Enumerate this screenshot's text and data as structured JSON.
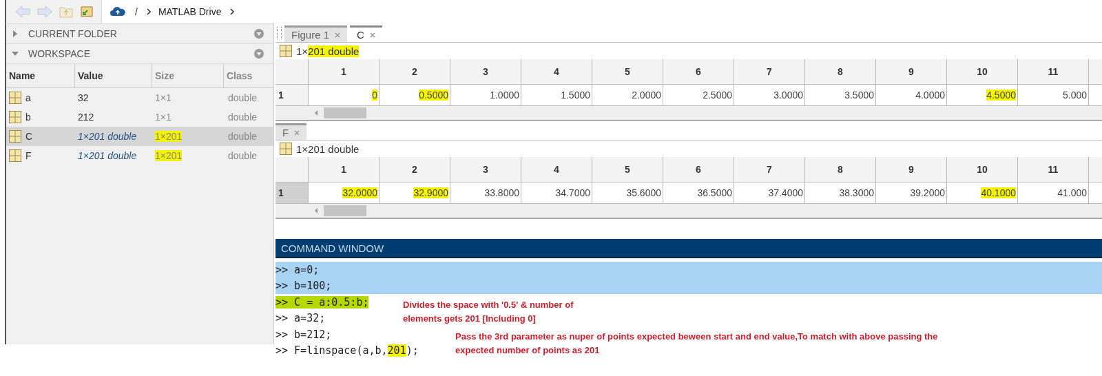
{
  "toolbar": {
    "separator": "/",
    "location": "MATLAB Drive"
  },
  "sidebar": {
    "sections": [
      {
        "title": "CURRENT FOLDER",
        "expanded": false
      },
      {
        "title": "WORKSPACE",
        "expanded": true
      }
    ]
  },
  "workspace": {
    "columns": [
      "Name",
      "Value",
      "Size",
      "Class"
    ],
    "rows": [
      {
        "name": "a",
        "value": "32",
        "kind": "scalar",
        "size": "1×1",
        "size_highlight": false,
        "class": "double",
        "selected": false
      },
      {
        "name": "b",
        "value": "212",
        "kind": "scalar",
        "size": "1×1",
        "size_highlight": false,
        "class": "double",
        "selected": false
      },
      {
        "name": "C",
        "value": "1×201 double",
        "kind": "array",
        "size": "1×201",
        "size_highlight": true,
        "class": "double",
        "selected": true
      },
      {
        "name": "F",
        "value": "1×201 double",
        "kind": "array",
        "size": "1×201",
        "size_highlight": true,
        "class": "double",
        "selected": false
      }
    ]
  },
  "editors": [
    {
      "tabs": [
        {
          "label": "Figure 1",
          "selected": false
        },
        {
          "label": "C",
          "selected": true
        }
      ],
      "title": [
        {
          "text": "1×",
          "highlight": false
        },
        {
          "text": "201 double",
          "highlight": true
        }
      ],
      "columns": [
        "1",
        "2",
        "3",
        "4",
        "5",
        "6",
        "7",
        "8",
        "9",
        "10",
        "11"
      ],
      "rows": [
        {
          "label": "1",
          "selected": false,
          "cells": [
            {
              "text": "0",
              "highlight": true
            },
            {
              "text": "0.5000",
              "highlight": true
            },
            {
              "text": "1.0000",
              "highlight": false
            },
            {
              "text": "1.5000",
              "highlight": false
            },
            {
              "text": "2.0000",
              "highlight": false
            },
            {
              "text": "2.5000",
              "highlight": false
            },
            {
              "text": "3.0000",
              "highlight": false
            },
            {
              "text": "3.5000",
              "highlight": false
            },
            {
              "text": "4.0000",
              "highlight": false
            },
            {
              "text": "4.5000",
              "highlight": true
            },
            {
              "text": "5.000",
              "highlight": false
            }
          ]
        }
      ]
    },
    {
      "tabs": [
        {
          "label": "F",
          "selected": false
        }
      ],
      "title": [
        {
          "text": "1×201 double",
          "highlight": false
        }
      ],
      "columns": [
        "1",
        "2",
        "3",
        "4",
        "5",
        "6",
        "7",
        "8",
        "9",
        "10",
        "11"
      ],
      "rows": [
        {
          "label": "1",
          "selected": true,
          "cells": [
            {
              "text": "32.0000",
              "highlight": true
            },
            {
              "text": "32.9000",
              "highlight": true
            },
            {
              "text": "33.8000",
              "highlight": false
            },
            {
              "text": "34.7000",
              "highlight": false
            },
            {
              "text": "35.6000",
              "highlight": false
            },
            {
              "text": "36.5000",
              "highlight": false
            },
            {
              "text": "37.4000",
              "highlight": false
            },
            {
              "text": "38.3000",
              "highlight": false
            },
            {
              "text": "39.2000",
              "highlight": false
            },
            {
              "text": "40.1000",
              "highlight": true
            },
            {
              "text": "41.000",
              "highlight": false
            }
          ]
        }
      ]
    }
  ],
  "command_window": {
    "title": "COMMAND WINDOW",
    "lines": [
      {
        "selected": true,
        "segments": [
          {
            "text": ">> a=0;",
            "highlight": false
          }
        ]
      },
      {
        "selected": true,
        "segments": [
          {
            "text": ">> b=100;",
            "highlight": false
          }
        ]
      },
      {
        "selected": false,
        "segments": [
          {
            "text": ">> C = a:0.5:b;",
            "highlight": true,
            "color": "#b5d800"
          }
        ]
      },
      {
        "selected": false,
        "segments": [
          {
            "text": ">> a=32;",
            "highlight": false
          }
        ]
      },
      {
        "selected": false,
        "segments": [
          {
            "text": ">> b=212;",
            "highlight": false
          }
        ]
      },
      {
        "selected": false,
        "segments": [
          {
            "text": ">> F=linspace(a,b,",
            "highlight": false
          },
          {
            "text": "201",
            "highlight": true,
            "color": "#f4f400"
          },
          {
            "text": ");",
            "highlight": false
          }
        ]
      }
    ],
    "notes": [
      {
        "lines": [
          "Divides the space with '0.5' & number of",
          "elements gets 201 [Including 0]"
        ]
      },
      {
        "lines": [
          "Pass the 3rd parameter as nuper of points expected beween start and end value,To match with above passing the",
          "expected number of points as 201"
        ]
      }
    ]
  }
}
